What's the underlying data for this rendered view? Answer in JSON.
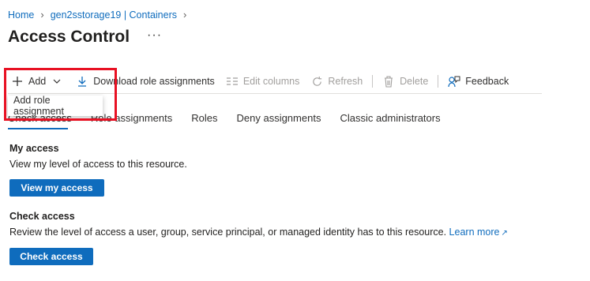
{
  "breadcrumb": {
    "home": "Home",
    "storage": "gen2sstorage19 | Containers"
  },
  "page": {
    "title": "Access Control",
    "more": "···"
  },
  "toolbar": {
    "add": "Add",
    "download": "Download role assignments",
    "edit_columns": "Edit columns",
    "refresh": "Refresh",
    "delete": "Delete",
    "feedback": "Feedback"
  },
  "dropdown": {
    "add_role_assignment": "Add role assignment"
  },
  "tabs": [
    "Check access",
    "Role assignments",
    "Roles",
    "Deny assignments",
    "Classic administrators"
  ],
  "my_access": {
    "heading": "My access",
    "description": "View my level of access to this resource.",
    "button": "View my access"
  },
  "check_access": {
    "heading": "Check access",
    "description": "Review the level of access a user, group, service principal, or managed identity has to this resource.",
    "learn_more": "Learn more",
    "button": "Check access"
  },
  "colors": {
    "accent": "#0f6cbd",
    "highlight": "#e81123"
  }
}
